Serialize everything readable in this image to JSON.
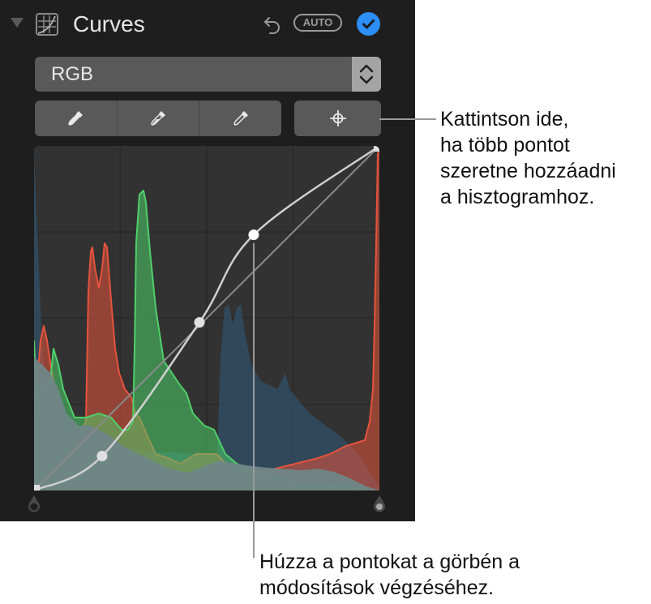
{
  "panel": {
    "title": "Curves",
    "icons": {
      "disclosure": "disclosure-triangle-down-icon",
      "section": "curves-icon",
      "reset": "undo-icon",
      "done": "checkmark-circle-icon"
    },
    "auto_label": "AUTO",
    "accent_color": "#2c8ef6"
  },
  "channel_select": {
    "selected": "RGB"
  },
  "eyedroppers": [
    {
      "name": "black-point-eyedropper",
      "icon": "eyedropper-filled-icon"
    },
    {
      "name": "gray-point-eyedropper",
      "icon": "eyedropper-half-icon"
    },
    {
      "name": "white-point-eyedropper",
      "icon": "eyedropper-outline-icon"
    }
  ],
  "add_points_button": {
    "icon": "crosshair-icon"
  },
  "histogram": {
    "colors": {
      "red": "#e5533d",
      "green": "#4fcf6a",
      "blue": "#2f5b7c",
      "luminance": "#6f8687"
    },
    "curve_points": [
      [
        0,
        0
      ],
      [
        0.197,
        0.1
      ],
      [
        0.479,
        0.488
      ],
      [
        0.636,
        0.742
      ],
      [
        1,
        1
      ]
    ],
    "black_point": 0,
    "white_point": 1
  },
  "callouts": {
    "add_points": "Kattintson ide,\nha több pontot\nszeretne hozzáadni\na hisztogramhoz.",
    "drag_points": "Húzza a pontokat a görbén a\nmódosítások végzéséhez."
  }
}
